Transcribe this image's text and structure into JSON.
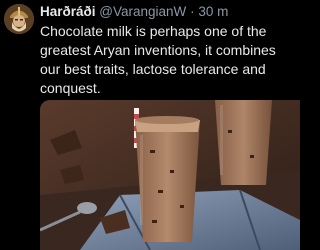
{
  "tweet": {
    "author_name": "Harðráði",
    "author_handle": "@VarangianW",
    "separator": "·",
    "timestamp": "30 m",
    "text": "Chocolate milk is perhaps one of the greatest Aryan inventions, it combines our best traits, lactose tolerance and conquest."
  },
  "colors": {
    "background": "#000000",
    "text": "#e7e9ea",
    "secondary_text": "#8b98a5"
  },
  "icons": {
    "avatar": "warrior-portrait-avatar",
    "media": "chocolate-milk-photo"
  }
}
